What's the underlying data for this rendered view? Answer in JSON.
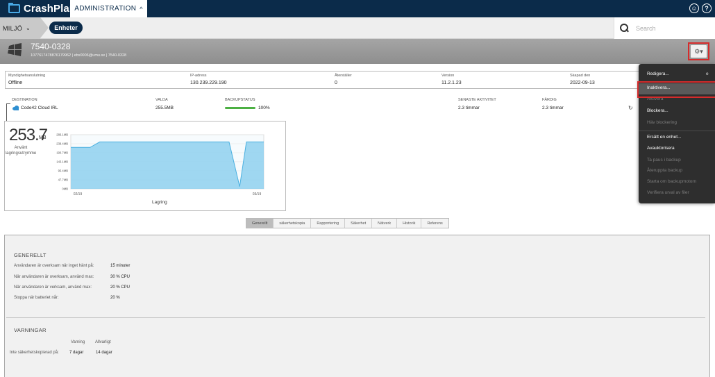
{
  "app": {
    "name": "CrashPlan",
    "section_tab": "ADMINISTRATION"
  },
  "breadcrumb": {
    "env": "MILJÖ",
    "current": "Enheter"
  },
  "search": {
    "placeholder": "Search"
  },
  "device": {
    "name": "7540-0328",
    "subtitle": "1077617478876179962 | ebx0006@umu.se | 7540-0328"
  },
  "info": {
    "labels": [
      "Myndighetsanslutning",
      "IP-adress",
      "Återställer",
      "Version",
      "Skapad den"
    ],
    "values": [
      "Offline",
      "130.239.229.190",
      "0",
      "11.2.1.23",
      "2022-09-13"
    ]
  },
  "destination": {
    "labels": [
      "DESTINATION",
      "VALDA",
      "BACKUPSTATUS",
      "SENASTE AKTIVITET",
      "FÄRDIG"
    ],
    "name": "Code42 Cloud IRL",
    "selected": "255.5MB",
    "backup_percent": "100%",
    "progress": 1.0,
    "last_activity": "2.3 timmar",
    "done": "2.3 timmar"
  },
  "chart_data": {
    "type": "area",
    "title": "Lagring",
    "big_value": "253.7",
    "big_unit": "MB",
    "big_label": "Använt lagringsutrymme",
    "y_ticks": [
      "286.1MB",
      "238.4MB",
      "190.7MB",
      "143.1MB",
      "95.4MB",
      "47.7MB",
      "0MB"
    ],
    "y_tick_values": [
      286.1,
      238.4,
      190.7,
      143.1,
      95.4,
      47.7,
      0
    ],
    "x_ticks": [
      "02/19",
      "03/19"
    ],
    "ylim": [
      0,
      286.1
    ],
    "x": [
      0,
      0.1,
      0.15,
      0.82,
      0.875,
      0.91,
      1.0
    ],
    "values": [
      219,
      219,
      248,
      248,
      12,
      248,
      248
    ],
    "color": "#8fd0ef"
  },
  "tabs": [
    "Generellt",
    "säkerhetskopia",
    "Rapportering",
    "Säkerhet",
    "Nätverk",
    "Historik",
    "Referens"
  ],
  "general": {
    "title": "GENERELLT",
    "rows": [
      {
        "label": "Användaren är overksam när inget hänt på:",
        "value": "15 minuter"
      },
      {
        "label": "När användaren är overksam, använd max:",
        "value": "30 % CPU"
      },
      {
        "label": "När användaren är verksam, använd max:",
        "value": "20 % CPU"
      },
      {
        "label": "Stoppa när batteriet når:",
        "value": "20 %"
      }
    ]
  },
  "warnings": {
    "title": "VARNINGAR",
    "col_warning": "Varning",
    "col_critical": "Allvarligt",
    "row_label": "Inte säkerhetskopierad på:",
    "warning_value": "7 dagar",
    "critical_value": "14 dagar"
  },
  "menu": {
    "items": [
      {
        "label": "Redigera...",
        "enabled": true
      },
      {
        "label": "Inaktivera...",
        "enabled": true
      },
      {
        "label": "Aktivera",
        "enabled": false
      },
      {
        "label": "Blockera...",
        "enabled": true
      },
      {
        "label": "Häv blockering",
        "enabled": false
      },
      {
        "label": "Ersätt en enhet...",
        "enabled": true
      },
      {
        "label": "Avauktorisera",
        "enabled": true
      },
      {
        "label": "Ta paus i backup",
        "enabled": false
      },
      {
        "label": "Återuppta backup",
        "enabled": false
      },
      {
        "label": "Starta om backupmotorn",
        "enabled": false
      },
      {
        "label": "Verifiera urval av filer",
        "enabled": false
      }
    ],
    "shortcut": "e"
  },
  "colors": {
    "topbar": "#0b2b4a",
    "accent": "#48a9e6",
    "highlight": "#d62b2b",
    "progress": "#4cb043"
  }
}
